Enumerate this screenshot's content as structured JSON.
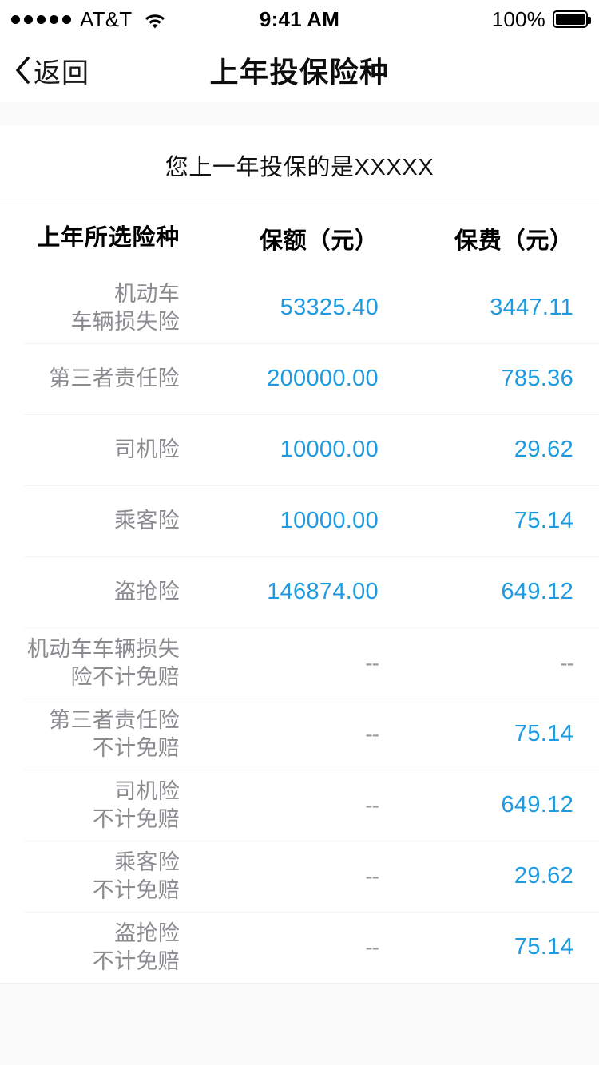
{
  "status_bar": {
    "signal_dots": 5,
    "carrier": "AT&T",
    "wifi_icon": "wifi-icon",
    "time": "9:41 AM",
    "battery_percent": "100%",
    "battery_icon": "battery-full-icon"
  },
  "nav": {
    "back_icon": "chevron-left-icon",
    "back_label": "返回",
    "title": "上年投保险种"
  },
  "subtitle": "您上一年投保的是XXXXX",
  "table": {
    "headers": {
      "name": "上年所选险种",
      "amount": "保额（元）",
      "premium": "保费（元）"
    },
    "empty_value": "--",
    "rows": [
      {
        "name": "机动车\n车辆损失险",
        "amount": "53325.40",
        "premium": "3447.11"
      },
      {
        "name": "第三者责任险",
        "amount": "200000.00",
        "premium": "785.36"
      },
      {
        "name": "司机险",
        "amount": "10000.00",
        "premium": "29.62"
      },
      {
        "name": "乘客险",
        "amount": "10000.00",
        "premium": "75.14"
      },
      {
        "name": "盗抢险",
        "amount": "146874.00",
        "premium": "649.12"
      },
      {
        "name": "机动车车辆损失\n险不计免赔",
        "amount": "--",
        "premium": "--"
      },
      {
        "name": "第三者责任险\n不计免赔",
        "amount": "--",
        "premium": "75.14"
      },
      {
        "name": "司机险\n不计免赔",
        "amount": "--",
        "premium": "649.12"
      },
      {
        "name": "乘客险\n不计免赔",
        "amount": "--",
        "premium": "29.62"
      },
      {
        "name": "盗抢险\n不计免赔",
        "amount": "--",
        "premium": "75.14"
      }
    ]
  },
  "colors": {
    "accent_blue": "#1e9be0",
    "label_gray": "#8a8a8f",
    "background": "#fafafb",
    "card": "#ffffff",
    "divider": "#f4f4f6"
  }
}
